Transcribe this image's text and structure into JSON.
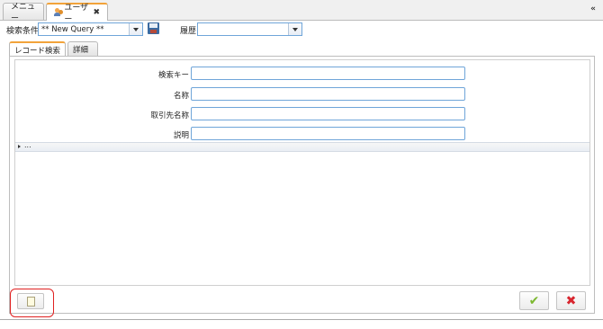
{
  "tabs": {
    "menu_label": "メニュー",
    "user_label": "ユーザー",
    "close_glyph": "✖",
    "collapse_glyph": "«"
  },
  "search": {
    "condition_label": "検索条件",
    "query_value": "** New Query **",
    "history_label": "履歴",
    "history_value": ""
  },
  "inner_tabs": {
    "record_search": "レコード検索",
    "detail": "詳細"
  },
  "form": {
    "fields": [
      {
        "label": "検索キー",
        "value": ""
      },
      {
        "label": "名称",
        "value": ""
      },
      {
        "label": "取引先名称",
        "value": ""
      },
      {
        "label": "説明",
        "value": ""
      }
    ],
    "expander_text": "..."
  },
  "footer": {
    "ok_glyph": "✔",
    "cancel_glyph": "✖"
  },
  "colors": {
    "accent_tab": "#f2a33a",
    "input_border": "#6fa5d9",
    "ok": "#7cb82f",
    "cancel": "#d8262f",
    "highlight": "#e02020"
  }
}
